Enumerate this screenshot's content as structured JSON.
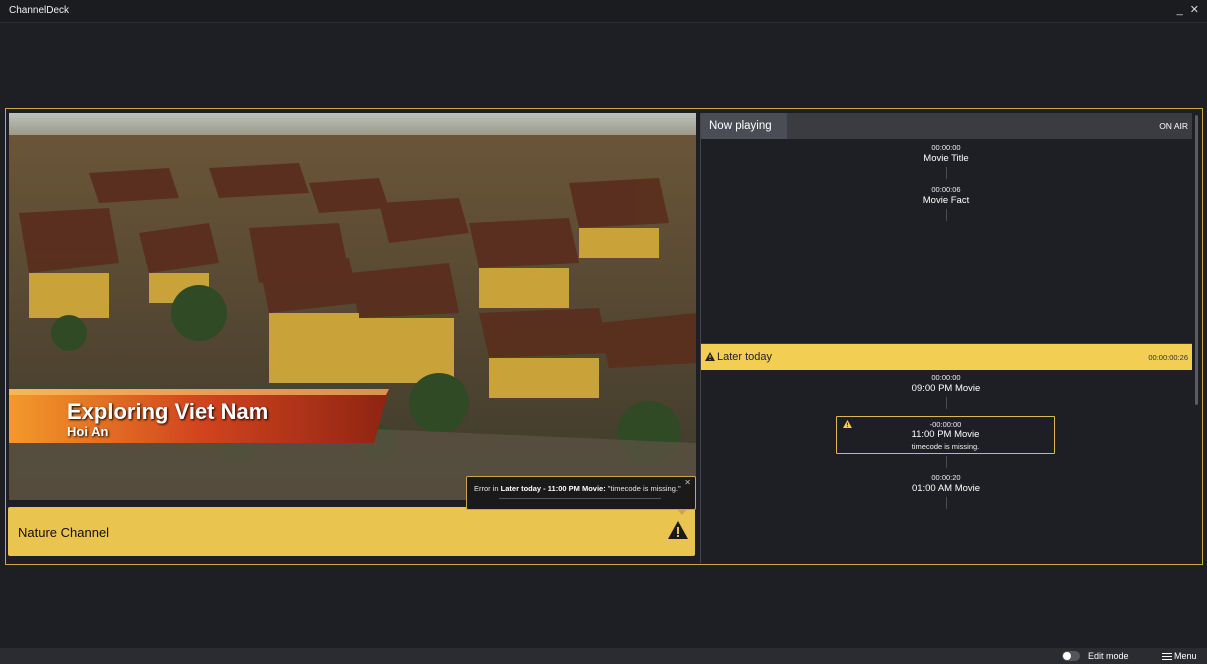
{
  "window": {
    "title": "ChannelDeck",
    "controls": "_ ✕"
  },
  "video": {
    "lower_third_title": "Exploring Viet Nam",
    "lower_third_subtitle": "Hoi An"
  },
  "channel": {
    "name": "Nature Channel",
    "warning_icon": "warning-triangle-icon"
  },
  "tooltip": {
    "prefix": "Error in ",
    "location": "Later today - 11:00 PM Movie:",
    "message": " \"timecode is missing.\"",
    "close": "✕"
  },
  "now_playing": {
    "tab_label": "Now playing",
    "status": "ON AIR",
    "items": [
      {
        "time": "00:00:00",
        "title": "Movie Title"
      },
      {
        "time": "00:00:06",
        "title": "Movie Fact"
      }
    ]
  },
  "later_today": {
    "label": "Later today",
    "total": "00:00:00:26",
    "items": [
      {
        "time": "00:00:00",
        "title": "09:00 PM Movie"
      },
      {
        "time": "-00:00:00",
        "title": "11:00 PM Movie",
        "error": "timecode is missing."
      },
      {
        "time": "00:00:20",
        "title": "01:00 AM Movie"
      }
    ]
  },
  "statusbar": {
    "edit_mode": "Edit mode",
    "menu": "Menu"
  },
  "colors": {
    "accent": "#f2cf53",
    "channel_bar": "#e9c44f",
    "frame": "#caa84a",
    "background": "#1d1f24"
  }
}
